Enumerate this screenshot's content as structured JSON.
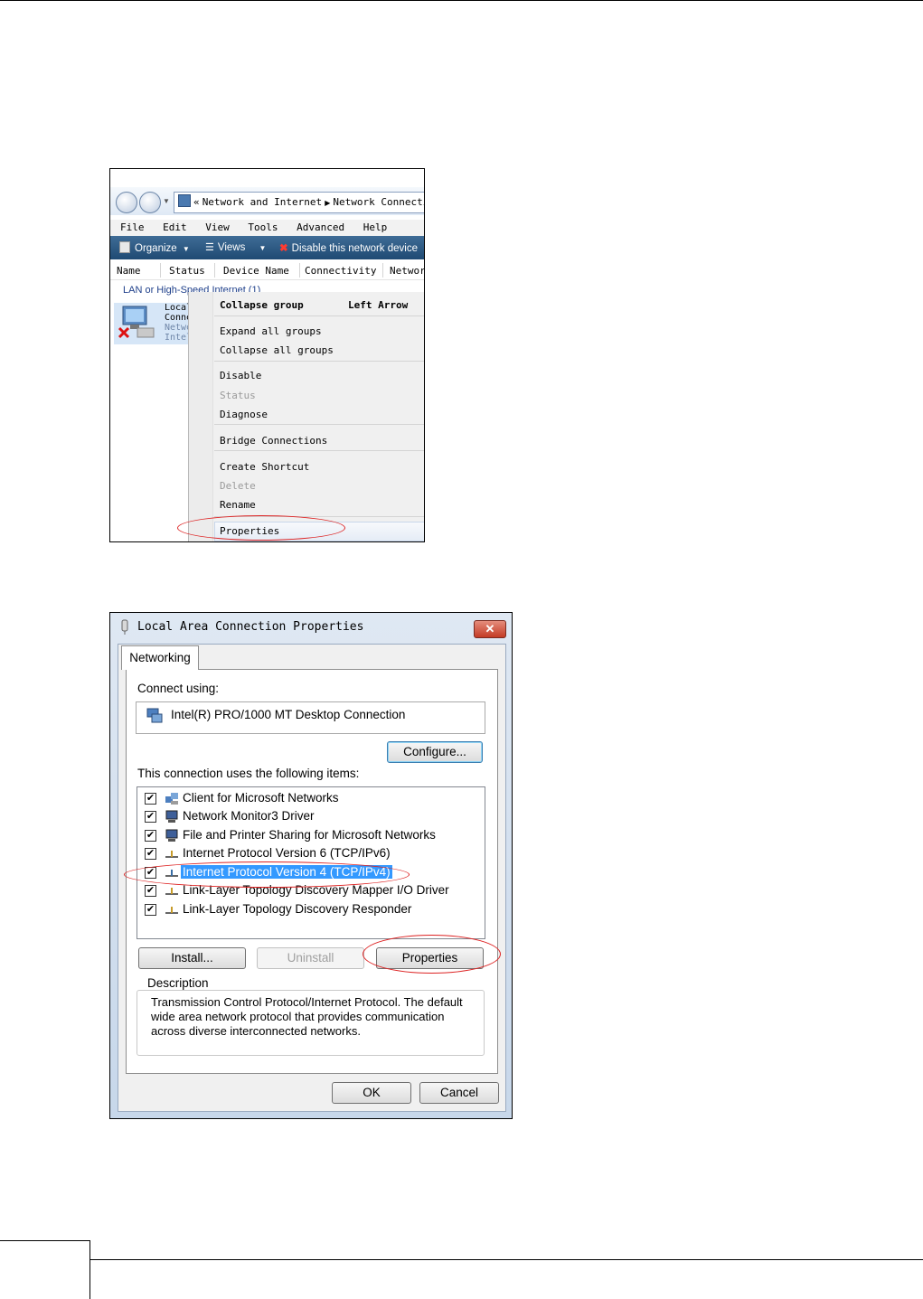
{
  "explorer": {
    "breadcrumb": [
      "«",
      "Network and Internet",
      "Network Connection"
    ],
    "menu": [
      "File",
      "Edit",
      "View",
      "Tools",
      "Advanced",
      "Help"
    ],
    "toolbar": {
      "organize": "Organize",
      "views": "Views",
      "disable": "Disable this network device"
    },
    "columns": [
      "Name",
      "Status",
      "Device Name",
      "Connectivity",
      "Networ"
    ],
    "group_header": "LAN or High-Speed Internet (1)",
    "item_lines": [
      "Local",
      "Conne",
      "Netwo",
      "Intel"
    ],
    "context_menu": {
      "collapse_group": "Collapse group",
      "collapse_group_shortcut": "Left Arrow",
      "expand_all": "Expand all groups",
      "collapse_all": "Collapse all groups",
      "disable": "Disable",
      "status": "Status",
      "diagnose": "Diagnose",
      "bridge": "Bridge Connections",
      "create_shortcut": "Create Shortcut",
      "delete": "Delete",
      "rename": "Rename",
      "properties": "Properties"
    }
  },
  "dialog": {
    "title": "Local Area Connection Properties",
    "close": "✕",
    "tab": "Networking",
    "connect_using_label": "Connect using:",
    "adapter": "Intel(R) PRO/1000 MT Desktop Connection",
    "configure": "Configure...",
    "items_label": "This connection uses the following items:",
    "items": [
      {
        "label": "Client for Microsoft Networks",
        "checked": true,
        "icon": "network-client-icon"
      },
      {
        "label": "Network Monitor3 Driver",
        "checked": true,
        "icon": "computer-icon"
      },
      {
        "label": "File and Printer Sharing for Microsoft Networks",
        "checked": true,
        "icon": "computer-icon"
      },
      {
        "label": "Internet Protocol Version 6 (TCP/IPv6)",
        "checked": true,
        "icon": "protocol-icon"
      },
      {
        "label": "Internet Protocol Version 4 (TCP/IPv4)",
        "checked": true,
        "icon": "protocol-icon",
        "selected": true
      },
      {
        "label": "Link-Layer Topology Discovery Mapper I/O Driver",
        "checked": true,
        "icon": "protocol-icon"
      },
      {
        "label": "Link-Layer Topology Discovery Responder",
        "checked": true,
        "icon": "protocol-icon"
      }
    ],
    "install": "Install...",
    "uninstall": "Uninstall",
    "properties": "Properties",
    "description_legend": "Description",
    "description": "Transmission Control Protocol/Internet Protocol. The default wide area network protocol that provides communication across diverse interconnected networks.",
    "ok": "OK",
    "cancel": "Cancel"
  },
  "colors": {
    "annotation": "#dd2222",
    "selection": "#3399ff",
    "toolbar": "#2b5682"
  }
}
